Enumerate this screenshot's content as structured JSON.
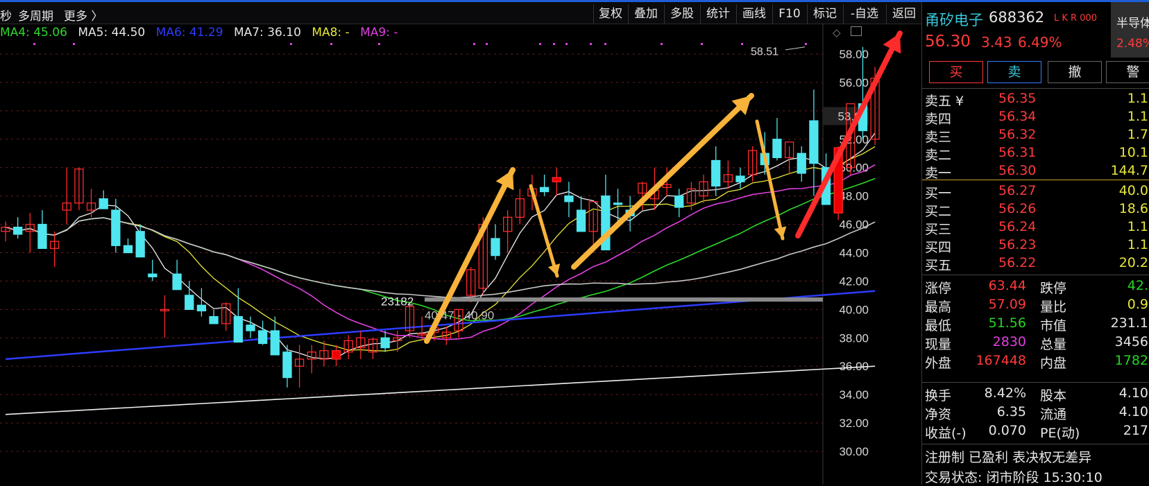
{
  "toolbar": {
    "left_items": [
      "秒",
      "多周期",
      "更多 〉"
    ],
    "buttons": [
      "复权",
      "叠加",
      "多股",
      "统计",
      "画线",
      "F10",
      "标记",
      "-自选",
      "返回"
    ]
  },
  "ma_legend": [
    {
      "label": "MA4: 45.06",
      "color": "#2bd92b"
    },
    {
      "label": "MA5: 44.50",
      "color": "#e6e6e6"
    },
    {
      "label": "MA6: 41.29",
      "color": "#2d3cff"
    },
    {
      "label": "MA7: 36.10",
      "color": "#e6e6e6"
    },
    {
      "label": "MA8: -",
      "color": "#e8e83a"
    },
    {
      "label": "MA9: -",
      "color": "#e040e0"
    }
  ],
  "chart": {
    "y_ticks": [
      "58.00",
      "56.00",
      "54.00",
      "52.00",
      "50.00",
      "48.00",
      "46.00",
      "44.00",
      "42.00",
      "40.00",
      "38.00",
      "36.00",
      "34.00",
      "32.00",
      "30.00"
    ],
    "current_price_tag": "53.63",
    "high_annotation": "58.51",
    "volume_annotation": "23182",
    "range_annotation": "40.47 - 40.90"
  },
  "chart_data": {
    "type": "candlestick",
    "y_range": [
      30,
      60
    ],
    "candles": [
      [
        45.5,
        46.2,
        44.8,
        45.8
      ],
      [
        45.8,
        46.5,
        45.0,
        45.3
      ],
      [
        45.5,
        46.8,
        44.0,
        46.0
      ],
      [
        46.0,
        47.0,
        45.2,
        44.3
      ],
      [
        44.3,
        45.5,
        43.0,
        44.8
      ],
      [
        47.0,
        50.0,
        46.0,
        47.5
      ],
      [
        47.5,
        50.0,
        47.0,
        49.9
      ],
      [
        47.0,
        48.5,
        46.5,
        47.5
      ],
      [
        47.8,
        48.4,
        47.2,
        47.1
      ],
      [
        47.0,
        47.8,
        44.0,
        44.5
      ],
      [
        44.5,
        45.0,
        44.0,
        44.0
      ],
      [
        45.5,
        46.0,
        44.0,
        43.7
      ],
      [
        42.5,
        43.5,
        42.0,
        42.3
      ],
      [
        40.0,
        41.0,
        38.0,
        40.0
      ],
      [
        42.5,
        43.5,
        41.5,
        41.4
      ],
      [
        41.0,
        42.0,
        40.5,
        40.0
      ],
      [
        40.3,
        41.5,
        39.5,
        39.9
      ],
      [
        39.5,
        40.0,
        39.0,
        39.0
      ],
      [
        39.0,
        40.5,
        38.5,
        40.4
      ],
      [
        39.5,
        41.5,
        38.0,
        37.7
      ],
      [
        38.9,
        39.5,
        38.0,
        38.5
      ],
      [
        38.5,
        39.2,
        37.5,
        37.6
      ],
      [
        38.5,
        39.5,
        37.0,
        36.8
      ],
      [
        37.0,
        37.5,
        34.5,
        35.2
      ],
      [
        36.0,
        37.5,
        34.5,
        36.5
      ],
      [
        36.5,
        37.5,
        35.5,
        37.0
      ],
      [
        36.5,
        37.8,
        36.0,
        37.1
      ],
      [
        36.5,
        37.5,
        36.0,
        37.1
      ],
      [
        37.0,
        38.2,
        36.5,
        37.8
      ],
      [
        37.3,
        38.5,
        36.5,
        38.0
      ],
      [
        37.0,
        38.0,
        36.5,
        37.9
      ],
      [
        38.0,
        38.5,
        37.0,
        37.3
      ],
      [
        37.8,
        38.5,
        37.0,
        38.0
      ],
      [
        38.5,
        40.5,
        38.0,
        40.2
      ],
      [
        38.2,
        39.5,
        37.8,
        38.3
      ],
      [
        38.4,
        39.0,
        37.8,
        38.7
      ],
      [
        38.0,
        38.8,
        37.5,
        38.4
      ],
      [
        38.5,
        40.0,
        38.0,
        40.0
      ],
      [
        41.0,
        43.0,
        40.5,
        42.8
      ],
      [
        41.5,
        46.5,
        41.0,
        46.0
      ],
      [
        45.0,
        46.0,
        43.5,
        43.8
      ],
      [
        45.5,
        47.0,
        44.0,
        46.5
      ],
      [
        46.5,
        48.5,
        46.0,
        47.8
      ],
      [
        48.0,
        49.5,
        47.0,
        48.5
      ],
      [
        48.6,
        49.5,
        48.0,
        48.3
      ],
      [
        49.0,
        50.0,
        48.0,
        49.3
      ],
      [
        48.0,
        49.0,
        46.5,
        47.6
      ],
      [
        47.0,
        48.0,
        45.5,
        45.5
      ],
      [
        45.5,
        47.0,
        44.0,
        47.6
      ],
      [
        48.0,
        49.5,
        45.0,
        44.2
      ],
      [
        47.5,
        48.5,
        46.0,
        47.4
      ],
      [
        47.0,
        48.0,
        45.5,
        46.6
      ],
      [
        48.2,
        49.0,
        47.0,
        48.9
      ],
      [
        47.8,
        50.0,
        47.0,
        48.4
      ],
      [
        48.6,
        50.0,
        48.0,
        48.8
      ],
      [
        48.0,
        48.5,
        46.5,
        47.2
      ],
      [
        47.5,
        49.0,
        47.0,
        48.5
      ],
      [
        48.0,
        49.5,
        47.5,
        49.0
      ],
      [
        50.5,
        51.5,
        48.0,
        48.7
      ],
      [
        49.0,
        50.5,
        48.5,
        49.5
      ],
      [
        49.4,
        50.0,
        48.5,
        49.0
      ],
      [
        49.5,
        51.5,
        49.0,
        51.2
      ],
      [
        51.0,
        52.5,
        49.5,
        50.2
      ],
      [
        52.0,
        53.5,
        50.5,
        50.7
      ],
      [
        50.7,
        51.5,
        49.5,
        51.8
      ],
      [
        51.0,
        51.5,
        49.0,
        49.6
      ],
      [
        53.3,
        55.5,
        48.0,
        50.3
      ],
      [
        50.0,
        51.0,
        48.0,
        47.4
      ],
      [
        46.8,
        51.5,
        46.3,
        51.4
      ],
      [
        50.0,
        53.5,
        49.5,
        54.5
      ],
      [
        54.5,
        58.5,
        52.0,
        52.6
      ],
      [
        52.0,
        57.1,
        51.6,
        56.3
      ]
    ],
    "last_price": 56.3,
    "high": 58.51
  },
  "quote": {
    "name": "甬矽电子",
    "code": "688362",
    "tag": "L K R 000",
    "sector": "半导体",
    "sector_pct": "2.48%",
    "price": "56.30",
    "change": "3.43",
    "change_pct": "6.49%",
    "btn_buy": "买",
    "btn_sell": "卖",
    "btn_cancel": "撤",
    "btn_alert": "警"
  },
  "asks": [
    {
      "label": "卖五 ¥",
      "price": "56.35",
      "vol": "1.1"
    },
    {
      "label": "卖四",
      "price": "56.34",
      "vol": "1.1"
    },
    {
      "label": "卖三",
      "price": "56.32",
      "vol": "1.7"
    },
    {
      "label": "卖二",
      "price": "56.31",
      "vol": "10.1"
    },
    {
      "label": "卖一",
      "price": "56.30",
      "vol": "144.7"
    }
  ],
  "bids": [
    {
      "label": "买一",
      "price": "56.27",
      "vol": "40.0"
    },
    {
      "label": "买二",
      "price": "56.26",
      "vol": "18.6"
    },
    {
      "label": "买三",
      "price": "56.24",
      "vol": "1.1"
    },
    {
      "label": "买四",
      "price": "56.23",
      "vol": "1.1"
    },
    {
      "label": "买五",
      "price": "56.22",
      "vol": "20.2"
    }
  ],
  "stats": [
    {
      "l1": "涨停",
      "v1": "63.44",
      "c1": "#ff3b3b",
      "l2": "跌停",
      "v2": "42.",
      "c2": "#26d426"
    },
    {
      "l1": "最高",
      "v1": "57.09",
      "c1": "#ff3b3b",
      "l2": "量比",
      "v2": "0.9",
      "c2": "#e8e83a"
    },
    {
      "l1": "最低",
      "v1": "51.56",
      "c1": "#26d426",
      "l2": "市值",
      "v2": "231.1",
      "c2": "#e6e6e6"
    },
    {
      "l1": "现量",
      "v1": "2830",
      "c1": "#e040e0",
      "l2": "总量",
      "v2": "3456",
      "c2": "#e6e6e6"
    },
    {
      "l1": "外盘",
      "v1": "167448",
      "c1": "#ff3b3b",
      "l2": "内盘",
      "v2": "1782",
      "c2": "#26d426"
    }
  ],
  "fund": [
    {
      "l1": "换手",
      "v1": "8.42%",
      "l2": "股本",
      "v2": "4.10"
    },
    {
      "l1": "净资",
      "v1": "6.35",
      "l2": "流通",
      "v2": "4.10"
    },
    {
      "l1": "收益(-)",
      "v1": "0.070",
      "l2": "PE(动)",
      "v2": "217"
    }
  ],
  "footer": {
    "line1": "注册制 已盈利 表决权无差异",
    "line2": "交易状态: 闭市阶段 15:30:10"
  }
}
